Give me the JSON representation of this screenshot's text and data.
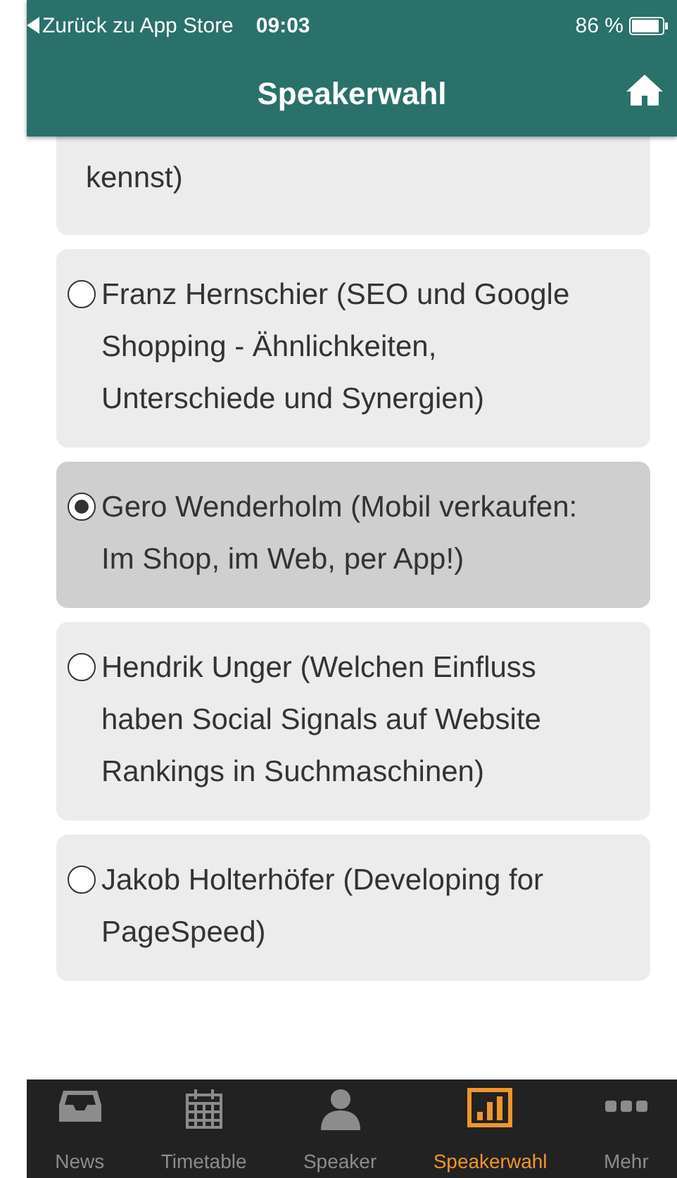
{
  "status_bar": {
    "back_label": "Zurück zu App Store",
    "time": "09:03",
    "battery": "86 %"
  },
  "header": {
    "title": "Speakerwahl"
  },
  "options": [
    {
      "kind": "continued",
      "label": "kennst)",
      "selected": false
    },
    {
      "kind": "option",
      "label": "Franz Hernschier (SEO und Google Shopping - Ähnlichkeiten, Unterschiede und Synergien)",
      "selected": false
    },
    {
      "kind": "option",
      "label": "Gero Wenderholm (Mobil verkaufen: Im Shop, im Web, per App!)",
      "selected": true
    },
    {
      "kind": "option",
      "label": "Hendrik Unger (Welchen Einfluss haben Social Signals auf Website Rankings in Suchmaschinen)",
      "selected": false
    },
    {
      "kind": "option",
      "label": "Jakob Holterhöfer (Developing for PageSpeed)",
      "selected": false
    }
  ],
  "tab_bar": [
    {
      "kind": "inbox",
      "label": "News",
      "selected": false
    },
    {
      "kind": "calendar",
      "label": "Timetable",
      "selected": false
    },
    {
      "kind": "person",
      "label": "Speaker",
      "selected": false
    },
    {
      "kind": "chart",
      "label": "Speakerwahl",
      "selected": true
    },
    {
      "kind": "dots",
      "label": "Mehr",
      "selected": false
    }
  ]
}
